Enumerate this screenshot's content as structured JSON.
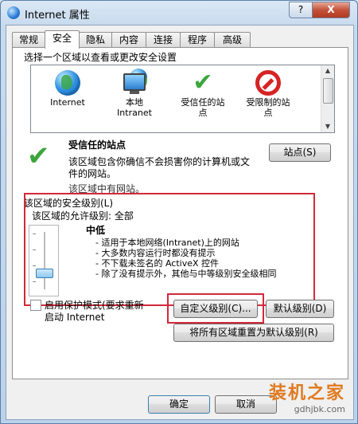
{
  "window": {
    "title": "Internet 属性",
    "help_label": "?",
    "close_label": "X"
  },
  "tabs": [
    "常规",
    "安全",
    "隐私",
    "内容",
    "连接",
    "程序",
    "高级"
  ],
  "zone_prompt": "选择一个区域以查看或更改安全设置",
  "zones": [
    {
      "label": "Internet",
      "icon": "globe-icon"
    },
    {
      "label": "本地\nIntranet",
      "icon": "intranet-icon"
    },
    {
      "label": "受信任的站\n点",
      "icon": "check-icon"
    },
    {
      "label": "受限制的站\n点",
      "icon": "no-entry-icon"
    }
  ],
  "selected_zone": {
    "name": "受信任的站点",
    "description_line1": "该区域包含你确信不会损害你的计算机或文",
    "description_line2": "件的网站。",
    "description_line3": "该区域中有网站。",
    "sites_button": "站点(S)"
  },
  "security_level": {
    "group_label": "该区域的安全级别(L)",
    "allowed_label": "该区域的允许级别: 全部",
    "level_name": "中低",
    "bullets": [
      "- 适用于本地网络(Intranet)上的网站",
      "- 大多数内容运行时都没有提示",
      "- 不下载未签名的 ActiveX 控件",
      "- 除了没有提示外，其他与中等级别安全级相同"
    ]
  },
  "protected_mode": {
    "line1": "启用保护模式(要求重新",
    "line2": "启动 Internet"
  },
  "buttons": {
    "custom_level": "自定义级别(C)...",
    "default_level": "默认级别(D)",
    "reset_all": "将所有区域重置为默认级别(R)",
    "ok": "确定",
    "cancel": "取消"
  },
  "watermark": {
    "line1": "装机之家",
    "line2": "gdhjbk.com"
  },
  "colors": {
    "highlight_box": "#d3283a",
    "check_green": "#3ba63b",
    "no_entry_red": "#d62323"
  }
}
